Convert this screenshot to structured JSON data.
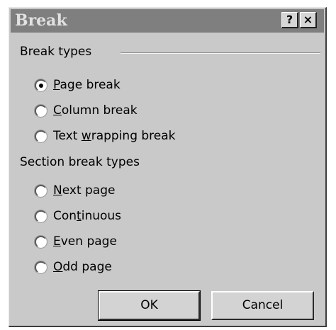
{
  "window": {
    "title": "Break",
    "help_label": "?",
    "close_label": "×"
  },
  "break_types": {
    "heading": "Break types",
    "options": [
      {
        "pre": "",
        "key": "P",
        "post": "age break",
        "selected": true
      },
      {
        "pre": "",
        "key": "C",
        "post": "olumn break",
        "selected": false
      },
      {
        "pre": "Text ",
        "key": "w",
        "post": "rapping break",
        "selected": false
      }
    ]
  },
  "section_break_types": {
    "heading": "Section break types",
    "options": [
      {
        "pre": "",
        "key": "N",
        "post": "ext page",
        "selected": false
      },
      {
        "pre": "Con",
        "key": "t",
        "post": "inuous",
        "selected": false
      },
      {
        "pre": "",
        "key": "E",
        "post": "ven page",
        "selected": false
      },
      {
        "pre": "",
        "key": "O",
        "post": "dd page",
        "selected": false
      }
    ]
  },
  "buttons": {
    "ok_label": "OK",
    "cancel_label": "Cancel"
  }
}
